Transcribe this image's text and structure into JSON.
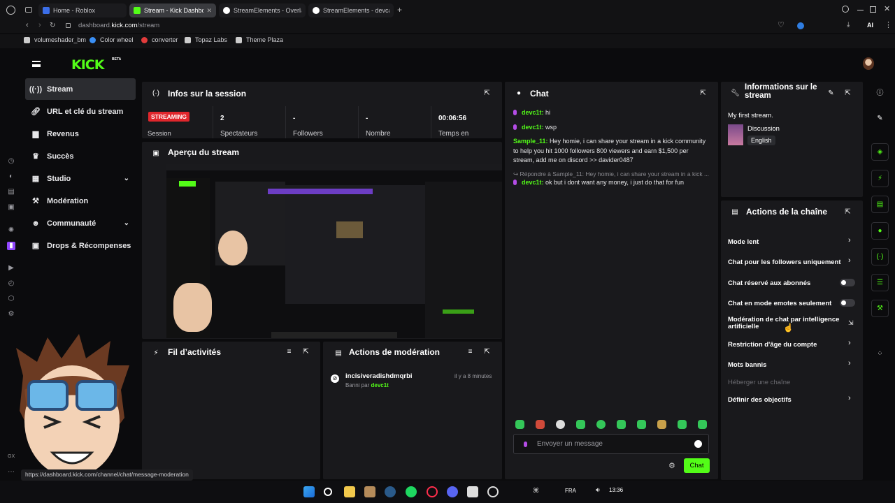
{
  "browser": {
    "tabs": [
      {
        "title": "Home - Roblox",
        "active": false,
        "color": "#3b6ee8"
      },
      {
        "title": "Stream - Kick Dashbo",
        "active": true,
        "color": "#53fc18"
      },
      {
        "title": "StreamElements - Overlay",
        "active": false,
        "color": "#ffffff"
      },
      {
        "title": "StreamElements - devcat-t",
        "active": false,
        "color": "#ffffff"
      }
    ],
    "url_host": "dashboard.",
    "url_bold": "kick.com",
    "url_path": "/stream",
    "bookmarks": [
      {
        "label": "volumeshader_bm",
        "color": "#cccccc"
      },
      {
        "label": "Color wheel",
        "color": "#3a8ff5"
      },
      {
        "label": "converter",
        "color": "#e23b3b"
      },
      {
        "label": "Topaz Labs",
        "color": "#cccccc"
      },
      {
        "label": "Theme Plaza",
        "color": "#cccccc"
      }
    ],
    "status_url": "https://dashboard.kick.com/channel/chat/message-moderation",
    "ai_label": "AI"
  },
  "brand": {
    "logo": "KICK",
    "beta": "BETA",
    "accent": "#53fc18"
  },
  "nav": {
    "items": [
      {
        "label": "Stream",
        "icon": "broadcast-icon",
        "active": true
      },
      {
        "label": "URL et clé du stream",
        "icon": "link-icon",
        "active": false
      },
      {
        "label": "Revenus",
        "icon": "chart-icon",
        "active": false
      },
      {
        "label": "Succès",
        "icon": "trophy-icon",
        "active": false
      },
      {
        "label": "Studio",
        "icon": "grid-icon",
        "active": false,
        "expandable": true
      },
      {
        "label": "Modération",
        "icon": "gavel-icon",
        "active": false
      },
      {
        "label": "Communauté",
        "icon": "people-icon",
        "active": false,
        "expandable": true
      },
      {
        "label": "Drops & Récompenses",
        "icon": "gift-icon",
        "active": false
      }
    ]
  },
  "session": {
    "title": "Infos sur la session",
    "status_badge": "STREAMING",
    "status_label": "Session",
    "stats": [
      {
        "value": "2",
        "label": "Spectateurs"
      },
      {
        "value": "-",
        "label": "Followers"
      },
      {
        "value": "-",
        "label": "Nombre"
      },
      {
        "value": "00:06:56",
        "label": "Temps en"
      }
    ]
  },
  "preview": {
    "title": "Aperçu du stream"
  },
  "activity": {
    "title": "Fil d’activités"
  },
  "moderation": {
    "title": "Actions de modération",
    "entries": [
      {
        "user": "incisiveradishdmqrbi",
        "action": "Banni par",
        "by": "devc1t",
        "time": "il y a 8 minutes"
      }
    ]
  },
  "chat": {
    "title": "Chat",
    "messages": [
      {
        "user": "devc1t:",
        "text": " hi",
        "badge": true
      },
      {
        "user": "devc1t:",
        "text": " wsp",
        "badge": true
      },
      {
        "user": "Sample_11:",
        "text": " Hey homie, i can share your stream in a kick community to help you hit 1000 followers 800 viewers and earn $1,500 per stream, add me on discord >> davider0487",
        "badge": false
      },
      {
        "reply": "Répondre à Sample_11: Hey homie, i can share your stream in a kick ..."
      },
      {
        "user": "devc1t:",
        "text": " ok but i dont want any money, i just do that for fun",
        "badge": true
      }
    ],
    "input_placeholder": "Envoyer un message",
    "send_label": "Chat"
  },
  "stream_info": {
    "title": "Informations sur le stream",
    "stream_title": "My first stream.",
    "category": "Discussion",
    "language": "English"
  },
  "channel_actions": {
    "title": "Actions de la chaîne",
    "items": [
      {
        "label": "Mode lent",
        "control": "chevron"
      },
      {
        "label": "Chat pour les followers uniquement",
        "control": "chevron"
      },
      {
        "label": "Chat réservé aux abonnés",
        "control": "toggle",
        "on": false
      },
      {
        "label": "Chat en mode emotes seulement",
        "control": "toggle",
        "on": false
      },
      {
        "label": "Modération de chat par intelligence artificielle",
        "control": "external"
      },
      {
        "label": "Restriction d'âge du compte",
        "control": "chevron"
      },
      {
        "label": "Mots bannis",
        "control": "chevron"
      },
      {
        "label": "Héberger une chaîne",
        "control": "none",
        "disabled": true
      },
      {
        "label": "Définir des objectifs",
        "control": "chevron"
      }
    ]
  },
  "taskbar": {
    "lang": "FRA",
    "time": "13:36"
  },
  "os_label": "GX"
}
